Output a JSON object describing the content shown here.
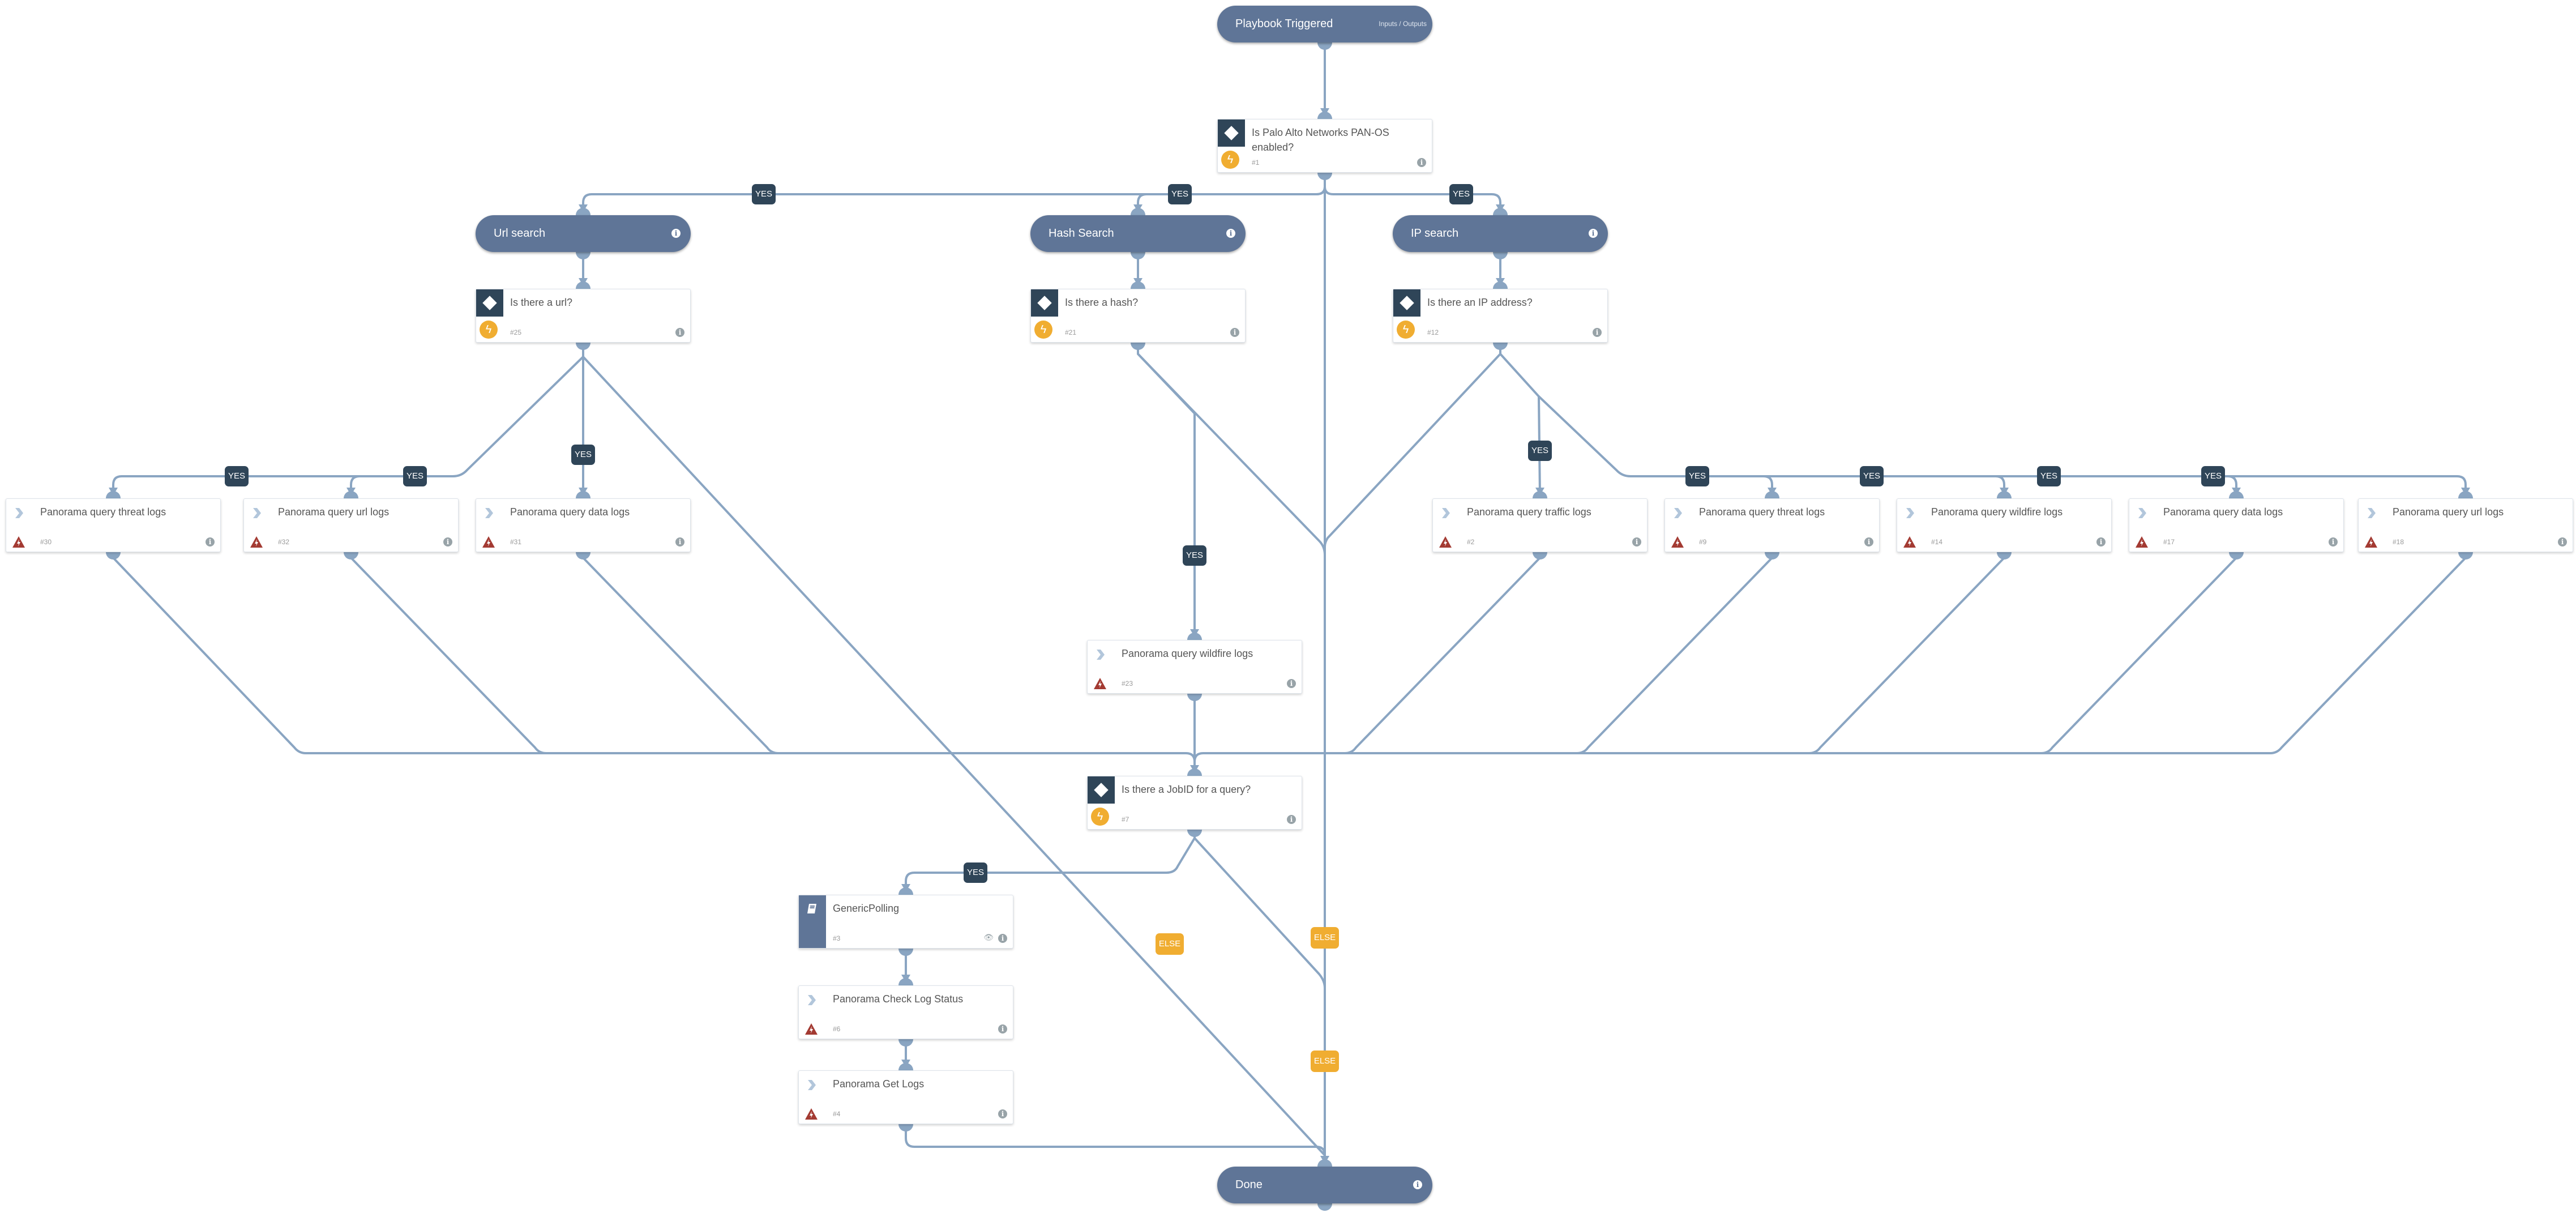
{
  "colors": {
    "edge": "#8aa5c2",
    "pill": "#5f7597",
    "condition_dark": "#2f4558",
    "automation_orange": "#f0ad31",
    "error_red": "#a33a32",
    "yes_label": "#2f4558",
    "else_label": "#f0ad31"
  },
  "nodes": {
    "start": {
      "title": "Playbook Triggered",
      "extra": "Inputs / Outputs"
    },
    "n1": {
      "title": "Is Palo Alto Networks PAN-OS enabled?",
      "num": "#1",
      "type": "condition"
    },
    "url_section": {
      "title": "Url search",
      "icon": "info-icon"
    },
    "hash_section": {
      "title": "Hash Search",
      "icon": "info-icon"
    },
    "ip_section": {
      "title": "IP search",
      "icon": "info-icon"
    },
    "n25": {
      "title": "Is there a url?",
      "num": "#25",
      "type": "condition"
    },
    "n21": {
      "title": "Is there a hash?",
      "num": "#21",
      "type": "condition"
    },
    "n12": {
      "title": "Is there an IP address?",
      "num": "#12",
      "type": "condition"
    },
    "n30": {
      "title": "Panorama query threat logs",
      "num": "#30",
      "type": "task"
    },
    "n32": {
      "title": "Panorama query url logs",
      "num": "#32",
      "type": "task"
    },
    "n31": {
      "title": "Panorama query data logs",
      "num": "#31",
      "type": "task"
    },
    "n2": {
      "title": "Panorama query traffic logs",
      "num": "#2",
      "type": "task"
    },
    "n9": {
      "title": "Panorama query threat logs",
      "num": "#9",
      "type": "task"
    },
    "n14": {
      "title": "Panorama query wildfire logs",
      "num": "#14",
      "type": "task"
    },
    "n17": {
      "title": "Panorama query data logs",
      "num": "#17",
      "type": "task"
    },
    "n18": {
      "title": "Panorama query url logs",
      "num": "#18",
      "type": "task"
    },
    "n23": {
      "title": "Panorama query wildfire logs",
      "num": "#23",
      "type": "task"
    },
    "n7": {
      "title": "Is there a JobID for a query?",
      "num": "#7",
      "type": "condition"
    },
    "n3": {
      "title": "GenericPolling",
      "num": "#3",
      "type": "playbook"
    },
    "n6": {
      "title": "Panorama Check Log Status",
      "num": "#6",
      "type": "task"
    },
    "n4": {
      "title": "Panorama Get Logs",
      "num": "#4",
      "type": "task"
    },
    "done": {
      "title": "Done",
      "icon": "info-icon"
    }
  },
  "labels": {
    "yes": "YES",
    "else": "ELSE"
  },
  "info_glyph": "i",
  "bolt_glyph": "ϟ",
  "eye_glyph": "👁"
}
